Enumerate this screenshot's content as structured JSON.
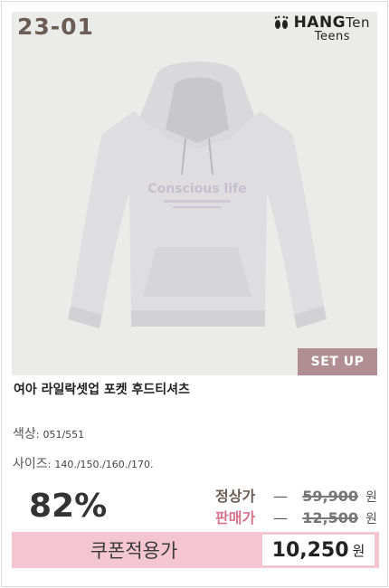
{
  "card": {
    "code": "23-01",
    "brand_name": "HANG",
    "brand_name_lc": "Ten",
    "brand_sub": "Teens",
    "badge": "SET UP",
    "hoodie_print": "Conscious life",
    "product_name": "여아 라일락셋업 포켓 후드티셔츠"
  },
  "specs": {
    "color_label": "색상",
    "color_value": "051/551",
    "size_label": "사이즈",
    "size_value": "140./150./160./170."
  },
  "pricing": {
    "discount": "82%",
    "regular_label": "정상가",
    "regular_amount": "59,900",
    "sale_label": "판매가",
    "sale_amount": "12,500",
    "unit": "원",
    "dash": "—"
  },
  "coupon": {
    "label": "쿠폰적용가",
    "price": "10,250",
    "unit": "원"
  },
  "colors": {
    "code": "#6b5d56",
    "badge": "#b18e93",
    "sale_label": "#d6738d",
    "coupon_band": "#f4c6d2"
  },
  "icons": {
    "brand": "feet-icon"
  }
}
